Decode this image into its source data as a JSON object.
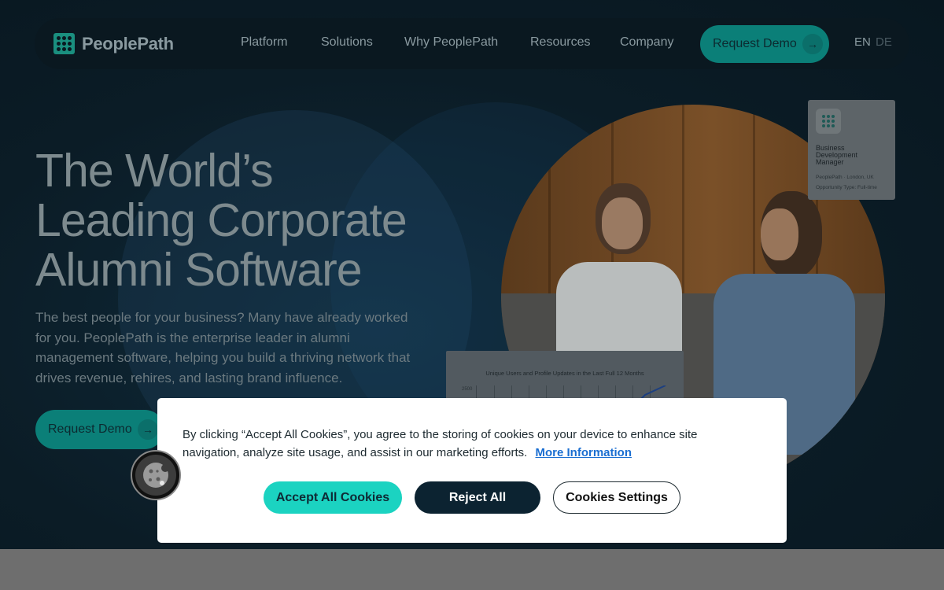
{
  "brand": {
    "name": "PeoplePath"
  },
  "nav": {
    "links": [
      "Platform",
      "Solutions",
      "Why PeoplePath",
      "Resources",
      "Company"
    ],
    "cta_label": "Request Demo",
    "lang_active": "EN",
    "lang_other": "DE"
  },
  "hero": {
    "title_line1": "The World’s",
    "title_line2": "Leading Corporate",
    "title_line3": "Alumni Software",
    "subtitle": "The best people for your business? Many have already worked for you. PeoplePath is the enterprise leader in alumni management software, helping you build a thriving network that drives revenue, rehires, and lasting brand influence.",
    "cta_label": "Request Demo"
  },
  "job_card": {
    "title": "Business Development Manager",
    "location": "PeoplePath · London, UK",
    "type": "Opportunity Type: Full-time"
  },
  "chart_card": {
    "title": "Unique Users and Profile Updates in the Last Full 12 Months",
    "axis_label": "2500"
  },
  "cookie": {
    "text": "By clicking “Accept All Cookies”, you agree to the storing of cookies on your device to enhance site navigation, analyze site usage, and assist in our marketing efforts.",
    "more_info_label": "More Information",
    "accept_label": "Accept All Cookies",
    "reject_label": "Reject All",
    "settings_label": "Cookies Settings"
  },
  "icons": {
    "logo": "peoplepath-logo-icon",
    "arrow": "arrow-right-icon",
    "cookie": "cookie-icon"
  },
  "colors": {
    "accent_teal": "#1bd3c1",
    "dark_navy": "#0c2331",
    "link_blue": "#1a6ed1"
  }
}
